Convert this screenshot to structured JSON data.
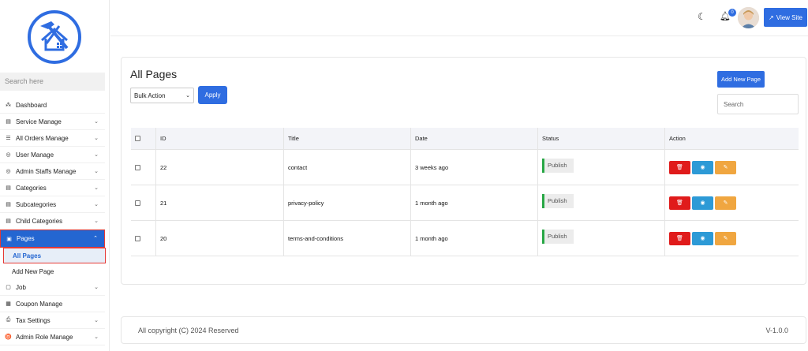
{
  "sidebar": {
    "search_placeholder": "Search here",
    "items": [
      {
        "label": "Dashboard",
        "icon": "dashboard-icon",
        "has_chevron": false
      },
      {
        "label": "Service Manage",
        "icon": "table-icon",
        "has_chevron": true
      },
      {
        "label": "All Orders Manage",
        "icon": "list-icon",
        "has_chevron": true
      },
      {
        "label": "User Manage",
        "icon": "user-circle-icon",
        "has_chevron": true
      },
      {
        "label": "Admin Staffs Manage",
        "icon": "user-circle-icon",
        "has_chevron": true
      },
      {
        "label": "Categories",
        "icon": "table-icon",
        "has_chevron": true
      },
      {
        "label": "Subcategories",
        "icon": "table-icon",
        "has_chevron": true
      },
      {
        "label": "Child Categories",
        "icon": "table-icon",
        "has_chevron": true
      },
      {
        "label": "Pages",
        "icon": "page-icon",
        "has_chevron": true,
        "active": true
      }
    ],
    "sub_items": [
      {
        "label": "All Pages",
        "current": true
      },
      {
        "label": "Add New Page",
        "current": false
      }
    ],
    "items_after": [
      {
        "label": "Job",
        "icon": "briefcase-icon",
        "has_chevron": true
      },
      {
        "label": "Coupon Manage",
        "icon": "coupon-icon",
        "has_chevron": false
      },
      {
        "label": "Tax Settings",
        "icon": "tax-icon",
        "has_chevron": true
      },
      {
        "label": "Admin Role Manage",
        "icon": "role-icon",
        "has_chevron": true
      }
    ]
  },
  "topbar": {
    "notification_count": "0",
    "view_site_label": "View Site"
  },
  "main": {
    "title": "All Pages",
    "bulk_action_value": "Bulk Action",
    "apply_label": "Apply",
    "add_new_label": "Add New Page",
    "search_placeholder": "Search",
    "columns": [
      "ID",
      "Title",
      "Date",
      "Status",
      "Action"
    ],
    "rows": [
      {
        "id": "22",
        "title": "contact",
        "date": "3 weeks ago",
        "status": "Publish"
      },
      {
        "id": "21",
        "title": "privacy-policy",
        "date": "1 month ago",
        "status": "Publish"
      },
      {
        "id": "20",
        "title": "terms-and-conditions",
        "date": "1 month ago",
        "status": "Publish"
      }
    ]
  },
  "footer": {
    "copyright": "All copyright (C) 2024 Reserved",
    "version": "V-1.0.0"
  },
  "colors": {
    "primary": "#2f6de1",
    "active_nav": "#2466d1",
    "highlight_border": "#e53935",
    "delete": "#e01b1b",
    "view": "#2d9ad6",
    "edit": "#f0a640",
    "publish_accent": "#28a745"
  }
}
